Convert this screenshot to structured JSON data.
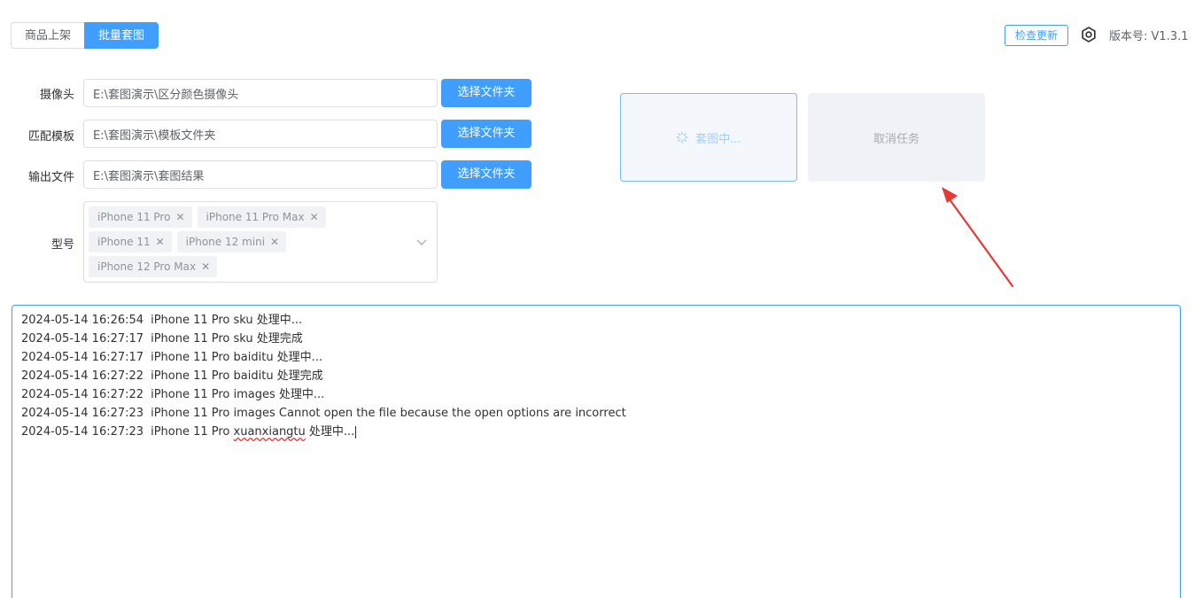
{
  "tabs": [
    {
      "label": "商品上架",
      "active": false
    },
    {
      "label": "批量套图",
      "active": true
    }
  ],
  "header": {
    "update_button": "检查更新",
    "version_label": "版本号:",
    "version_value": "V1.3.1"
  },
  "form": {
    "camera": {
      "label": "摄像头",
      "value": "E:\\套图演示\\区分颜色摄像头",
      "button": "选择文件夹"
    },
    "template": {
      "label": "匹配模板",
      "value": "E:\\套图演示\\模板文件夹",
      "button": "选择文件夹"
    },
    "output": {
      "label": "输出文件",
      "value": "E:\\套图演示\\套图结果",
      "button": "选择文件夹"
    },
    "model": {
      "label": "型号",
      "tags": [
        "iPhone 11 Pro",
        "iPhone 11 Pro Max",
        "iPhone 11",
        "iPhone 12 mini",
        "iPhone 12 Pro Max"
      ]
    }
  },
  "actions": {
    "run_label": "套图中...",
    "cancel_label": "取消任务"
  },
  "log": [
    {
      "time": "2024-05-14 16:26:54",
      "text": "iPhone 11 Pro sku 处理中..."
    },
    {
      "time": "2024-05-14 16:27:17",
      "text": "iPhone 11 Pro sku 处理完成"
    },
    {
      "time": "2024-05-14 16:27:17",
      "text": "iPhone 11 Pro baiditu 处理中..."
    },
    {
      "time": "2024-05-14 16:27:22",
      "text": "iPhone 11 Pro baiditu 处理完成"
    },
    {
      "time": "2024-05-14 16:27:22",
      "text": "iPhone 11 Pro images 处理中..."
    },
    {
      "time": "2024-05-14 16:27:23",
      "text": "iPhone 11 Pro images Cannot open the file because the open options are incorrect"
    },
    {
      "time": "2024-05-14 16:27:23",
      "text_before": "iPhone 11 Pro ",
      "text_flagged": "xuanxiangtu",
      "text_after": " 处理中..."
    }
  ],
  "colors": {
    "accent": "#409eff",
    "annotation": "#e53935"
  }
}
